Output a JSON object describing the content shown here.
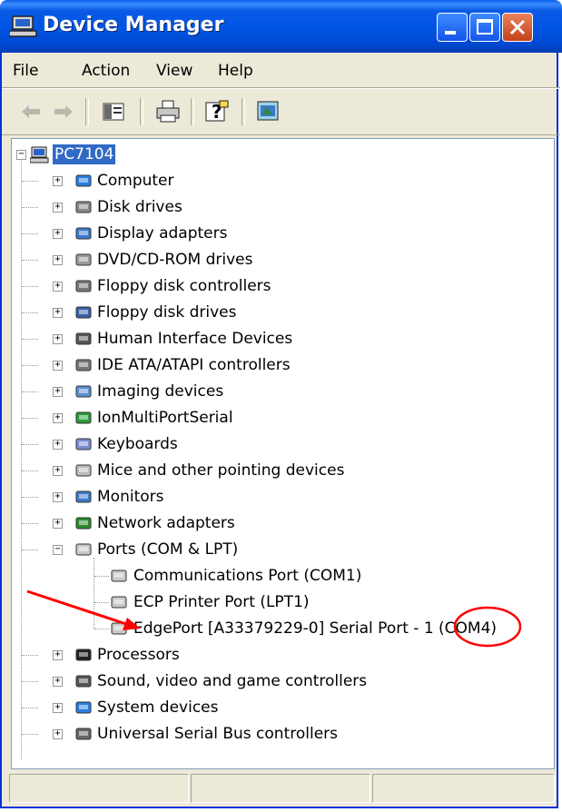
{
  "window": {
    "title": "Device Manager",
    "controls": [
      "minimize",
      "maximize",
      "close"
    ]
  },
  "menu": [
    "File",
    "Action",
    "View",
    "Help"
  ],
  "toolbar": {
    "icons": [
      "back-arrow-icon",
      "forward-arrow-icon",
      "show-hide-tree-icon",
      "print-icon",
      "help-icon",
      "properties-icon"
    ]
  },
  "tree": {
    "root": "PC7104",
    "categories": [
      "Computer",
      "Disk drives",
      "Display adapters",
      "DVD/CD-ROM drives",
      "Floppy disk controllers",
      "Floppy disk drives",
      "Human Interface Devices",
      "IDE ATA/ATAPI controllers",
      "Imaging devices",
      "IonMultiPortSerial",
      "Keyboards",
      "Mice and other pointing devices",
      "Monitors",
      "Network adapters"
    ],
    "ports": {
      "label": "Ports (COM & LPT)",
      "children": [
        "Communications Port (COM1)",
        "ECP Printer Port (LPT1)",
        "EdgePort [A33379229-0] Serial Port - 1 (COM4)"
      ]
    },
    "after_ports": [
      "Processors",
      "Sound, video and game controllers",
      "System devices",
      "Universal Serial Bus controllers"
    ]
  },
  "annotation": {
    "arrow_color": "#ff0000",
    "circle_color": "#ff0000"
  },
  "colors": {
    "titlebar": "#0054e3",
    "selection": "#316ac5",
    "close_button": "#d9542f"
  }
}
